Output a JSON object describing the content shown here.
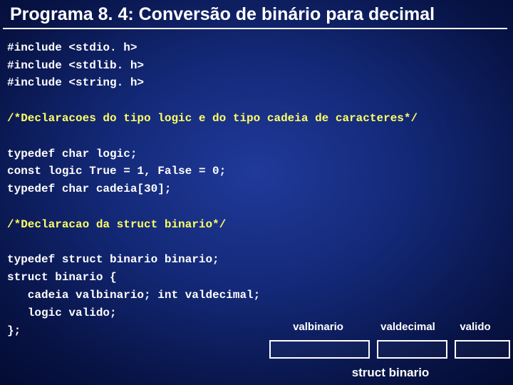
{
  "title": "Programa 8. 4: Conversão de binário para decimal",
  "code": {
    "inc1": "#include <stdio. h>",
    "inc2": "#include <stdlib. h>",
    "inc3": "#include <string. h>",
    "cmt1": "/*Declaracoes do tipo logic e do tipo cadeia de caracteres*/",
    "typedef1": "typedef char logic;",
    "consts": "const logic True = 1, False = 0;",
    "typedef2": "typedef char cadeia[30];",
    "cmt2": "/*Declaracao da struct binario*/",
    "typedef3": "typedef struct binario binario;",
    "struct1": "struct binario {",
    "struct2": "   cadeia valbinario; int valdecimal;",
    "struct3": "   logic valido;",
    "struct4": "};"
  },
  "diagram": {
    "h1": "valbinario",
    "h2": "valdecimal",
    "h3": "valido",
    "caption": "struct binario"
  }
}
